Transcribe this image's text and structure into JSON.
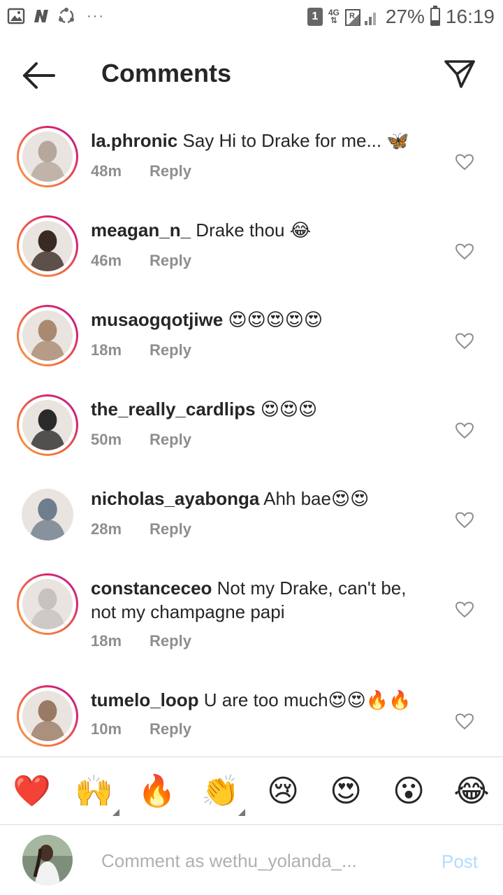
{
  "status_bar": {
    "sim_slot": "1",
    "network": "4G",
    "battery_pct": "27%",
    "battery_level": 0.27,
    "time": "16:19",
    "dots": "···"
  },
  "header": {
    "title": "Comments",
    "back_icon": "arrow-left-icon",
    "share_icon": "paper-plane-icon"
  },
  "comments": [
    {
      "username": "la.phronic",
      "text": " Say Hi to Drake for me... 🦋",
      "time": "48m",
      "reply": "Reply",
      "story_ring": true,
      "avatar_color": "#b5a79c"
    },
    {
      "username": "meagan_n_",
      "text": " Drake thou 😂",
      "time": "46m",
      "reply": "Reply",
      "story_ring": true,
      "avatar_color": "#3a2a24"
    },
    {
      "username": "musaogqotjiwe",
      "text": " 😍😍😍😍😍",
      "time": "18m",
      "reply": "Reply",
      "story_ring": true,
      "avatar_color": "#a98a70"
    },
    {
      "username": "the_really_cardlips",
      "text": " 😍😍😍",
      "time": "50m",
      "reply": "Reply",
      "story_ring": true,
      "avatar_color": "#2a2a2a"
    },
    {
      "username": "nicholas_ayabonga",
      "text": " Ahh bae😍😍",
      "time": "28m",
      "reply": "Reply",
      "story_ring": false,
      "avatar_color": "#6f7d8c"
    },
    {
      "username": "constanceceo",
      "text": " Not my Drake, can't be, not my champagne papi",
      "time": "18m",
      "reply": "Reply",
      "story_ring": true,
      "avatar_color": "#c8c2be"
    },
    {
      "username": "tumelo_loop",
      "text": " U are too much😍😍🔥🔥",
      "time": "10m",
      "reply": "Reply",
      "story_ring": true,
      "avatar_color": "#9a7a64"
    }
  ],
  "emoji_bar": [
    "❤️",
    "🙌",
    "🔥",
    "👏",
    "😢",
    "😍",
    "😮",
    "😂"
  ],
  "input": {
    "placeholder": "Comment as wethu_yolanda_...",
    "post_label": "Post"
  },
  "colors": {
    "text": "#262626",
    "meta": "#8e8e8e",
    "post_disabled": "#b3dbff",
    "story_ring_start": "#f9a040",
    "story_ring_end": "#b52894"
  }
}
